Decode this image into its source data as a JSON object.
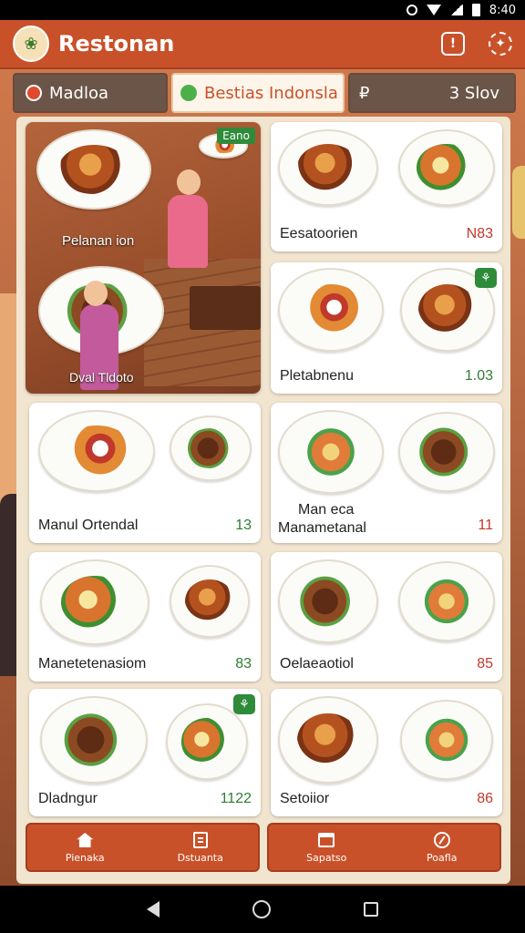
{
  "status_bar": {
    "time": "8:40"
  },
  "header": {
    "title": "Restonan",
    "alert_label": "!",
    "icons": [
      "logo-icon",
      "alert-icon",
      "settings-icon"
    ]
  },
  "tabs": [
    {
      "label": "Madloa",
      "icon": "red-dot-icon"
    },
    {
      "label": "Bestias Indonsla",
      "icon": "green-leaf-icon"
    },
    {
      "label": "3 Slov",
      "prefix": "₽"
    }
  ],
  "featured": {
    "badge": "Eano",
    "label_top": "Pelanan ion",
    "label_bottom": "Dval Tldoto"
  },
  "cards": [
    {
      "name": "Eesatoorien",
      "price": "N83",
      "price_color": "red"
    },
    {
      "name": "Pletabnenu",
      "price": "1.03",
      "price_color": "green"
    },
    {
      "name": "Manul Ortendal",
      "price": "13",
      "price_color": "green"
    },
    {
      "name_line1": "Man eca",
      "name_line2": "Manametanal",
      "price": "11",
      "price_color": "red"
    },
    {
      "name": "Manetetenasiom",
      "price": "83",
      "price_color": "green"
    },
    {
      "name": "Oelaeaotiol",
      "price": "85",
      "price_color": "red"
    },
    {
      "name": "Dladngur",
      "price": "1122",
      "price_color": "green"
    },
    {
      "name": "Setoiior",
      "price": "86",
      "price_color": "red"
    }
  ],
  "bottom_nav": [
    {
      "label": "Pienaka",
      "icon": "home-icon"
    },
    {
      "label": "Dstuanta",
      "icon": "clipboard-icon"
    },
    {
      "label": "Sapatso",
      "icon": "calendar-icon"
    },
    {
      "label": "Poafla",
      "icon": "compass-icon"
    }
  ],
  "colors": {
    "primary": "#c9512a",
    "dark_tab": "#6b5548",
    "price_red": "#c0392b",
    "price_green": "#2e7d32"
  }
}
